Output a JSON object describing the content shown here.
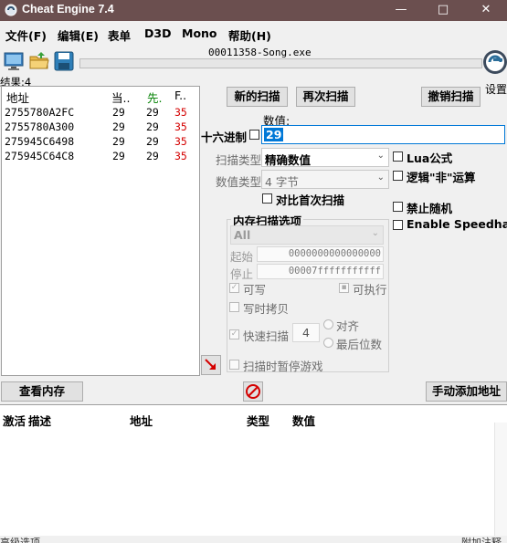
{
  "window": {
    "title": "Cheat Engine 7.4",
    "minimize": "—",
    "maximize": "□",
    "close": "✕"
  },
  "menu": [
    "文件(F)",
    "编辑(E)",
    "表单",
    "D3D",
    "Mono",
    "帮助(H)"
  ],
  "toolbar": {
    "process_icon": "computer-icon",
    "open_icon": "open-folder-icon",
    "save_icon": "save-disk-icon",
    "process_name": "00011358-Song.exe",
    "settings_label": "设置",
    "logo_icon": "cheat-engine-logo-icon"
  },
  "results": {
    "count_label": "结果:4",
    "headers": [
      "地址",
      "当..",
      "先.",
      "F.."
    ],
    "rows": [
      {
        "address": "2755780A2FC",
        "current": "29",
        "previous": "29",
        "first": "35"
      },
      {
        "address": "2755780A300",
        "current": "29",
        "previous": "29",
        "first": "35"
      },
      {
        "address": "275945C6498",
        "current": "29",
        "previous": "29",
        "first": "35"
      },
      {
        "address": "275945C64C8",
        "current": "29",
        "previous": "29",
        "first": "35"
      }
    ]
  },
  "scan": {
    "new_scan": "新的扫描",
    "next_scan": "再次扫描",
    "undo_scan": "撤销扫描",
    "value_label": "数值:",
    "hex_label": "十六进制",
    "value": "29",
    "scan_type_label": "扫描类型",
    "scan_type": "精确数值",
    "value_type_label": "数值类型",
    "value_type": "4 字节",
    "compare_first": "对比首次扫描",
    "lua_formula": "Lua公式",
    "not_logic": "逻辑\"非\"运算",
    "no_random": "禁止随机",
    "speedhack": "Enable Speedhack"
  },
  "memory_options": {
    "title": "内存扫描选项",
    "region": "All",
    "start_label": "起始",
    "start": "0000000000000000",
    "stop_label": "停止",
    "stop": "00007fffffffffff",
    "writable": "可写",
    "executable": "可执行",
    "copy_on_write": "写时拷贝",
    "fast_scan": "快速扫描",
    "fast_scan_value": "4",
    "alignment": "对齐",
    "last_digits": "最后位数",
    "pause_game": "扫描时暂停游戏"
  },
  "bottom": {
    "view_memory": "查看内存",
    "add_address": "手动添加地址",
    "add_arrow_icon": "red-arrow-icon",
    "clear_icon": "no-entry-icon"
  },
  "address_table": {
    "headers": [
      "激活",
      "描述",
      "地址",
      "类型",
      "数值"
    ]
  },
  "status": {
    "left": "高级选项",
    "right": "附加注释"
  },
  "colors": {
    "titlebar": "#6b4f4f",
    "selection": "#0078d7",
    "first_value": "#d40000",
    "previous_header": "#008000"
  }
}
